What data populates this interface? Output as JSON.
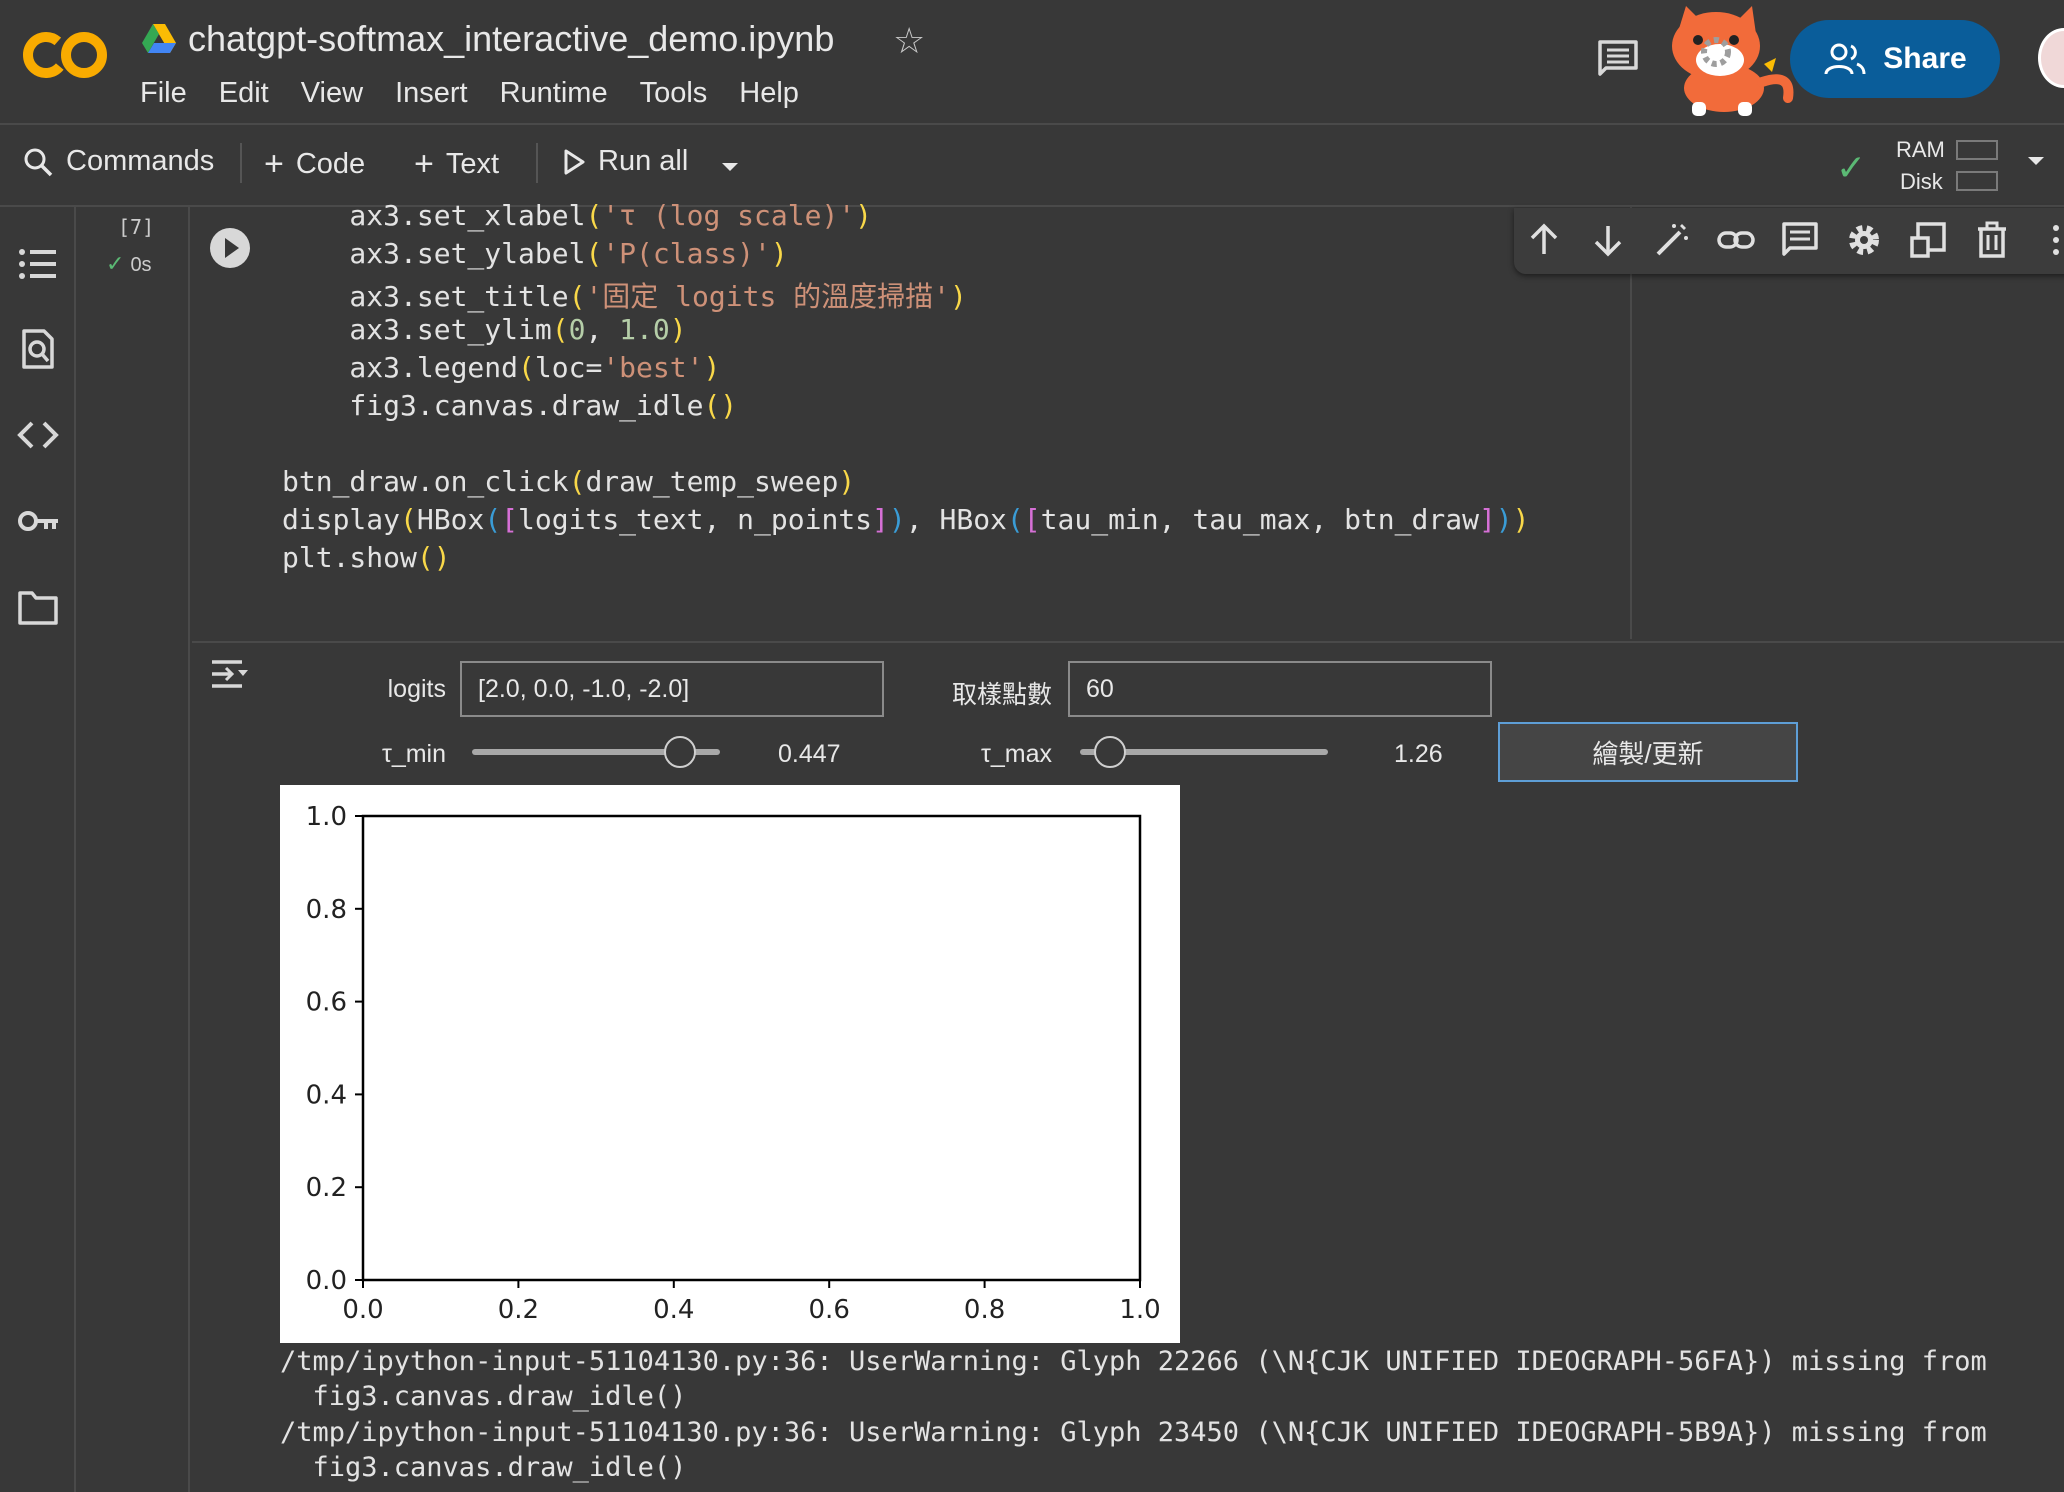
{
  "header": {
    "title": "chatgpt-softmax_interactive_demo.ipynb",
    "menu": [
      "File",
      "Edit",
      "View",
      "Insert",
      "Runtime",
      "Tools",
      "Help"
    ],
    "share_label": "Share"
  },
  "toolbar": {
    "commands_label": "Commands",
    "code_label": "Code",
    "text_label": "Text",
    "run_all_label": "Run all",
    "ram_label": "RAM",
    "disk_label": "Disk"
  },
  "cell": {
    "execution_count": "[7]",
    "status": "0s"
  },
  "code_lines": [
    {
      "indent": "    ",
      "fn": "ax3.set_xlabel",
      "args": "'τ (log scale)'"
    },
    {
      "indent": "    ",
      "fn": "ax3.set_ylabel",
      "args": "'P(class)'"
    },
    {
      "indent": "    ",
      "fn": "ax3.set_title",
      "args": "'固定 logits 的溫度掃描'"
    },
    {
      "indent": "    ",
      "fn": "ax3.set_ylim",
      "args": "0, 1.0"
    },
    {
      "indent": "    ",
      "fn": "ax3.legend",
      "args": "loc='best'"
    },
    {
      "indent": "    ",
      "fn": "fig3.canvas.draw_idle",
      "args": ""
    },
    {
      "indent": "",
      "fn": "btn_draw.on_click",
      "args": "draw_temp_sweep"
    },
    {
      "indent": "",
      "fn": "display",
      "args": "HBox([logits_text, n_points]), HBox([tau_min, tau_max, btn_draw])"
    },
    {
      "indent": "",
      "fn": "plt.show",
      "args": ""
    }
  ],
  "widgets": {
    "logits_label": "logits",
    "logits_value": "[2.0, 0.0, -1.0, -2.0]",
    "n_points_label": "取樣點數",
    "n_points_value": "60",
    "tau_min_label": "τ_min",
    "tau_min_value": "0.447",
    "tau_min_position": 0.84,
    "tau_max_label": "τ_max",
    "tau_max_value": "1.26",
    "tau_max_position": 0.12,
    "draw_button_label": "繪製/更新"
  },
  "chart_data": {
    "type": "line",
    "series": [],
    "xlim": [
      0.0,
      1.0
    ],
    "ylim": [
      0.0,
      1.0
    ],
    "xticks": [
      "0.0",
      "0.2",
      "0.4",
      "0.6",
      "0.8",
      "1.0"
    ],
    "yticks": [
      "0.0",
      "0.2",
      "0.4",
      "0.6",
      "0.8",
      "1.0"
    ],
    "title": "",
    "xlabel": "",
    "ylabel": "",
    "grid": false
  },
  "warnings": [
    "/tmp/ipython-input-51104130.py:36: UserWarning: Glyph 22266 (\\N{CJK UNIFIED IDEOGRAPH-56FA}) missing from",
    "  fig3.canvas.draw_idle()",
    "/tmp/ipython-input-51104130.py:36: UserWarning: Glyph 23450 (\\N{CJK UNIFIED IDEOGRAPH-5B9A}) missing from",
    "  fig3.canvas.draw_idle()"
  ],
  "colors": {
    "background": "#383838",
    "share_button": "#0a5d9a",
    "success": "#5bb974",
    "button_focus": "#5e9ed6"
  }
}
